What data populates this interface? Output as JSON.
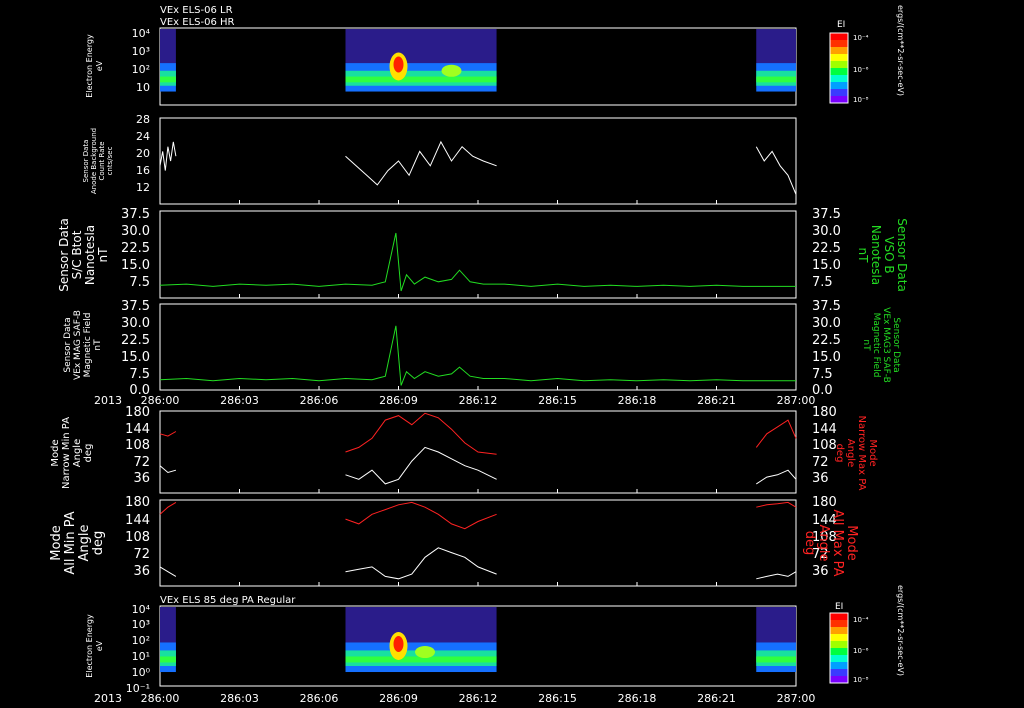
{
  "titles": {
    "panel1_line1": "VEx ELS-06 LR",
    "panel1_line2": "VEx ELS-06 HR",
    "panel7": "VEx ELS 85 deg PA Regular"
  },
  "time_axis": {
    "year_label": "2013",
    "ticks": [
      "286:00",
      "286:03",
      "286:06",
      "286:09",
      "286:12",
      "286:15",
      "286:18",
      "286:21",
      "287:00"
    ]
  },
  "colorbar": {
    "label": "EI",
    "unit": "ergs/(cm**2-sr-sec-eV)",
    "tick_labels": [
      "10⁻⁴",
      "10⁻⁶",
      "10⁻⁸"
    ],
    "colors": [
      "#7a00ff",
      "#3a3aff",
      "#00a0ff",
      "#00ffd0",
      "#00ff40",
      "#a0ff00",
      "#ffff00",
      "#ffa000",
      "#ff3000",
      "#ff0000"
    ]
  },
  "chart_data": [
    {
      "id": "p1",
      "type": "heatmap",
      "ylabel": [
        "Electron Energy",
        "eV"
      ],
      "ylim": [
        1,
        10000
      ],
      "yscale": "log",
      "ytick_labels": [
        "10⁴",
        "10³",
        "10²",
        "10"
      ],
      "data_intervals": [
        [
          "286:00",
          "286:00.6"
        ],
        [
          "286:07",
          "286:12.7"
        ],
        [
          "286:22.5",
          "287:00"
        ]
      ],
      "features": [
        {
          "time": "286:09",
          "energy_eV": 100,
          "level": "high"
        },
        {
          "time": "286:11",
          "energy_eV": 60,
          "level": "moderate"
        }
      ]
    },
    {
      "id": "p2",
      "type": "line",
      "ylabel": [
        "Sensor Data",
        "Anode Background",
        "Count Rate",
        "cnts/sec"
      ],
      "ylim": [
        10,
        28
      ],
      "ytick_labels": [
        "28",
        "24",
        "20",
        "16",
        "12"
      ],
      "series": [
        {
          "color": "#ffffff",
          "segments": [
            {
              "x": [
                0.0,
                0.1,
                0.2,
                0.3,
                0.4,
                0.5,
                0.6
              ],
              "y": [
                18,
                21,
                17,
                22,
                19,
                23,
                20
              ]
            },
            {
              "x": [
                7.0,
                7.4,
                7.8,
                8.2,
                8.6,
                9.0,
                9.4,
                9.8,
                10.2,
                10.6,
                11.0,
                11.4,
                11.8,
                12.2,
                12.7
              ],
              "y": [
                20,
                18,
                16,
                14,
                17,
                19,
                16,
                21,
                18,
                23,
                19,
                22,
                20,
                19,
                18
              ]
            },
            {
              "x": [
                22.5,
                22.8,
                23.1,
                23.4,
                23.7,
                24.0
              ],
              "y": [
                22,
                19,
                21,
                18,
                16,
                12
              ]
            }
          ]
        }
      ]
    },
    {
      "id": "p3",
      "type": "line",
      "ylabel": [
        "Sensor Data",
        "S/C Btot",
        "Nanotesla",
        "nT"
      ],
      "right_label": [
        "Sensor Data",
        "VSO B",
        "Nanotesla",
        "nT"
      ],
      "ylim": [
        0,
        37.5
      ],
      "ytick_labels": [
        "37.5",
        "30.0",
        "22.5",
        "15.0",
        "7.5"
      ],
      "series": [
        {
          "color": "#22dd22",
          "x": [
            0,
            1,
            2,
            3,
            4,
            5,
            6,
            7,
            8,
            8.5,
            8.9,
            9.1,
            9.3,
            9.6,
            10.0,
            10.5,
            11.0,
            11.3,
            11.7,
            12.2,
            13,
            14,
            15,
            16,
            17,
            18,
            19,
            20,
            21,
            22,
            23,
            24
          ],
          "y": [
            5.5,
            6,
            5,
            6,
            5.5,
            6,
            5,
            6,
            5.5,
            7,
            28,
            3,
            10,
            6,
            9,
            7,
            8,
            12,
            7,
            6,
            6,
            5,
            6,
            5,
            5.5,
            5,
            5.5,
            5,
            5.5,
            5,
            5,
            5
          ]
        }
      ]
    },
    {
      "id": "p4",
      "type": "line",
      "ylabel": [
        "Sensor Data",
        "VEx MAG SAF-B",
        "Magnetic Field",
        "nT"
      ],
      "right_label": [
        "Sensor Data",
        "VEx MAG3 SAF-B",
        "Magnetic Field",
        "nT"
      ],
      "ylim": [
        0,
        37.5
      ],
      "ytick_labels": [
        "37.5",
        "30.0",
        "22.5",
        "15.0",
        "7.5",
        "0.0"
      ],
      "series": [
        {
          "color": "#22dd22",
          "x": [
            0,
            1,
            2,
            3,
            4,
            5,
            6,
            7,
            8,
            8.5,
            8.9,
            9.1,
            9.3,
            9.6,
            10.0,
            10.5,
            11.0,
            11.3,
            11.7,
            12.2,
            13,
            14,
            15,
            16,
            17,
            18,
            19,
            20,
            21,
            22,
            23,
            24
          ],
          "y": [
            4.5,
            5,
            4,
            5,
            4.5,
            5,
            4,
            5,
            4.5,
            6,
            28,
            2,
            8,
            5,
            8,
            6,
            7,
            10,
            6,
            5,
            5,
            4,
            5,
            4,
            4.5,
            4,
            4.5,
            4,
            4.5,
            4,
            4,
            4
          ]
        }
      ]
    },
    {
      "id": "p5",
      "type": "line",
      "ylabel": [
        "Mode",
        "Narrow Min PA",
        "Angle",
        "deg"
      ],
      "right_label": [
        "Mode",
        "Narrow Max PA",
        "Angle",
        "deg"
      ],
      "ylim": [
        0,
        180
      ],
      "ytick_labels": [
        "180",
        "144",
        "108",
        "72",
        "36"
      ],
      "series": [
        {
          "color": "#ff2222",
          "segments": [
            {
              "x": [
                0.0,
                0.3,
                0.6
              ],
              "y": [
                130,
                125,
                135
              ]
            },
            {
              "x": [
                7.0,
                7.5,
                8.0,
                8.5,
                9.0,
                9.5,
                10.0,
                10.5,
                11.0,
                11.5,
                12.0,
                12.7
              ],
              "y": [
                90,
                100,
                120,
                160,
                170,
                150,
                175,
                165,
                140,
                110,
                90,
                85
              ]
            },
            {
              "x": [
                22.5,
                22.9,
                23.3,
                23.7,
                24.0
              ],
              "y": [
                100,
                130,
                145,
                160,
                120
              ]
            }
          ]
        },
        {
          "color": "#ffffff",
          "segments": [
            {
              "x": [
                0.0,
                0.3,
                0.6
              ],
              "y": [
                60,
                45,
                50
              ]
            },
            {
              "x": [
                7.0,
                7.5,
                8.0,
                8.5,
                9.0,
                9.5,
                10.0,
                10.5,
                11.0,
                11.5,
                12.0,
                12.7
              ],
              "y": [
                40,
                30,
                50,
                20,
                30,
                70,
                100,
                90,
                75,
                60,
                50,
                30
              ]
            },
            {
              "x": [
                22.5,
                22.9,
                23.3,
                23.7,
                24.0
              ],
              "y": [
                20,
                35,
                40,
                50,
                30
              ]
            }
          ]
        }
      ]
    },
    {
      "id": "p6",
      "type": "line",
      "ylabel": [
        "Mode",
        "All Min PA",
        "Angle",
        "deg"
      ],
      "right_label": [
        "Mode",
        "All Max PA",
        "Angle",
        "deg"
      ],
      "ylim": [
        0,
        180
      ],
      "ytick_labels": [
        "180",
        "144",
        "108",
        "72",
        "36"
      ],
      "series": [
        {
          "color": "#ff2222",
          "segments": [
            {
              "x": [
                0.0,
                0.3,
                0.6
              ],
              "y": [
                150,
                165,
                175
              ]
            },
            {
              "x": [
                7.0,
                7.5,
                8.0,
                8.5,
                9.0,
                9.5,
                10.0,
                10.5,
                11.0,
                11.5,
                12.0,
                12.7
              ],
              "y": [
                140,
                130,
                150,
                160,
                170,
                175,
                165,
                150,
                130,
                120,
                135,
                150
              ]
            },
            {
              "x": [
                22.5,
                22.9,
                23.3,
                23.7,
                24.0
              ],
              "y": [
                165,
                170,
                172,
                175,
                165
              ]
            }
          ]
        },
        {
          "color": "#ffffff",
          "segments": [
            {
              "x": [
                0.0,
                0.3,
                0.6
              ],
              "y": [
                40,
                30,
                20
              ]
            },
            {
              "x": [
                7.0,
                7.5,
                8.0,
                8.5,
                9.0,
                9.5,
                10.0,
                10.5,
                11.0,
                11.5,
                12.0,
                12.7
              ],
              "y": [
                30,
                35,
                40,
                20,
                15,
                25,
                60,
                80,
                70,
                60,
                40,
                25
              ]
            },
            {
              "x": [
                22.5,
                22.9,
                23.3,
                23.7,
                24.0
              ],
              "y": [
                15,
                20,
                25,
                20,
                30
              ]
            }
          ]
        }
      ]
    },
    {
      "id": "p7",
      "type": "heatmap",
      "ylabel": [
        "Electron Energy",
        "eV"
      ],
      "ylim": [
        1,
        10000
      ],
      "yscale": "log",
      "ytick_labels": [
        "10⁴",
        "10³",
        "10²",
        "10¹",
        "10⁰",
        "10⁻¹"
      ],
      "data_intervals": [
        [
          "286:00",
          "286:00.6"
        ],
        [
          "286:07",
          "286:12.7"
        ],
        [
          "286:22.5",
          "287:00"
        ]
      ],
      "features": [
        {
          "time": "286:09",
          "energy_eV": 100,
          "level": "high"
        },
        {
          "time": "286:10",
          "energy_eV": 50,
          "level": "moderate"
        }
      ]
    }
  ]
}
